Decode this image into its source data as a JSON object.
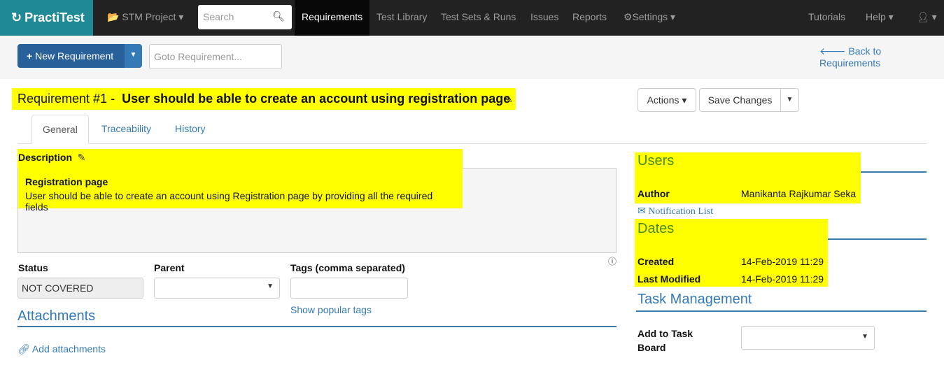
{
  "nav": {
    "logo": "PractiTest",
    "project": "STM Project",
    "search_placeholder": "Search",
    "items": [
      "Requirements",
      "Test Library",
      "Test Sets & Runs",
      "Issues",
      "Reports",
      "Settings"
    ],
    "tutorials": "Tutorials",
    "help": "Help"
  },
  "toolbar": {
    "new_requirement": "New Requirement",
    "goto_placeholder": "Goto Requirement...",
    "back": "Back to Requirements"
  },
  "header": {
    "title_prefix": "Requirement #1 -",
    "title": "User should be able to create an account using registration page",
    "actions": "Actions",
    "save": "Save Changes"
  },
  "tabs": [
    "General",
    "Traceability",
    "History"
  ],
  "description": {
    "label": "Description",
    "heading": "Registration page",
    "body": "User should be able to create an account using Registration page by providing all the required fields"
  },
  "fields": {
    "status_label": "Status",
    "status_value": "NOT COVERED",
    "parent_label": "Parent",
    "tags_label": "Tags (comma separated)",
    "popular_tags": "Show popular tags"
  },
  "attachments": {
    "title": "Attachments",
    "add": "Add attachments"
  },
  "users": {
    "title": "Users",
    "author_label": "Author",
    "author": "Manikanta Rajkumar Seka",
    "notification": "Notification List"
  },
  "dates": {
    "title": "Dates",
    "created_label": "Created",
    "created": "14-Feb-2019 11:29",
    "modified_label": "Last Modified",
    "modified": "14-Feb-2019 11:29"
  },
  "task": {
    "title": "Task Management",
    "board_label": "Add to Task Board"
  }
}
